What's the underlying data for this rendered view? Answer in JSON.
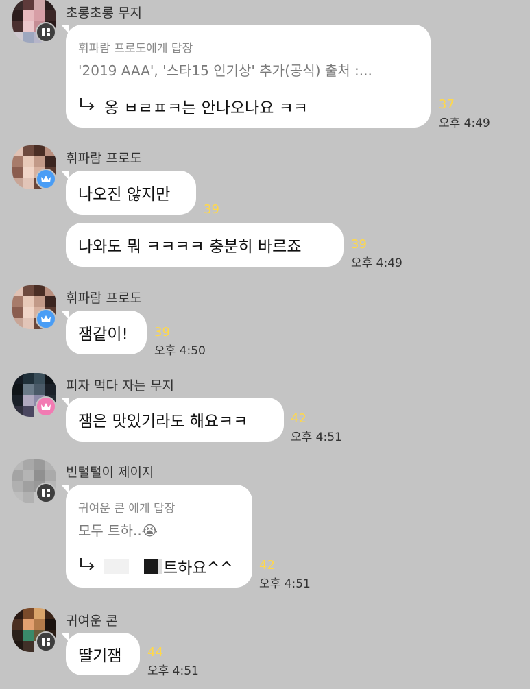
{
  "messages": [
    {
      "sender": "초롱초롱 무지",
      "reply_to": "휘파람 프로도에게 답장",
      "reply_quote": "'2019 AAA', '스타15 인기상' 추가(공식) 출처 :...",
      "text": "옹 ㅂㄹㅍㅋ는 안나오나요 ㅋㅋ",
      "count": "37",
      "time": "오후 4:49",
      "badge_icon": "layout-icon"
    },
    {
      "sender": "휘파람 프로도",
      "text1": "나오진 않지만",
      "count1": "39",
      "text2": "나와도 뭐 ㅋㅋㅋㅋ 충분히 바르죠",
      "count2": "39",
      "time": "오후 4:49",
      "badge_icon": "crown-icon"
    },
    {
      "sender": "휘파람 프로도",
      "text": "잼같이!",
      "count": "39",
      "time": "오후 4:50",
      "badge_icon": "crown-icon"
    },
    {
      "sender": "피자 먹다 자는 무지",
      "text": "잼은 맛있기라도 해요ㅋㅋ",
      "count": "42",
      "time": "오후 4:51",
      "badge_icon": "crown-icon"
    },
    {
      "sender": "빈털털이 제이지",
      "reply_to": "귀여운 콘 에게 답장",
      "reply_quote": "모두 트하..😭",
      "text": "트하요^^",
      "count": "42",
      "time": "오후 4:51",
      "badge_icon": "layout-icon"
    },
    {
      "sender": "귀여운 콘",
      "text": "딸기잼",
      "count": "44",
      "time": "오후 4:51",
      "badge_icon": "layout-icon"
    }
  ],
  "colors": {
    "background": "#c4c4c4",
    "bubble": "#ffffff",
    "unread_count": "#ffd84a",
    "crown_blue": "#4a9df5",
    "crown_pink": "#f27bb3"
  }
}
